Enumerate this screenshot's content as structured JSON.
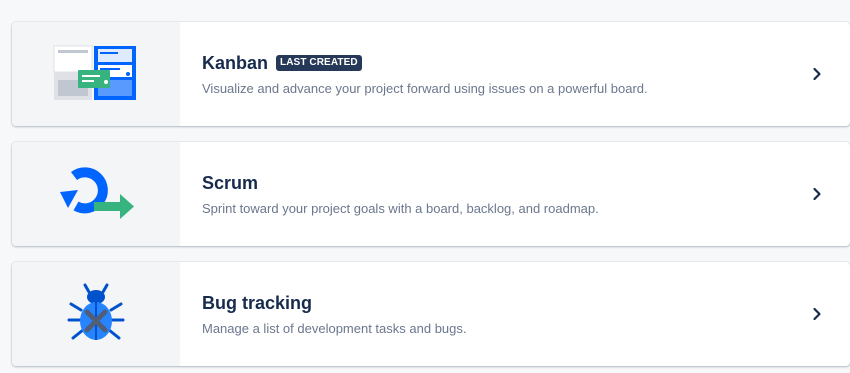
{
  "templates": [
    {
      "title": "Kanban",
      "badge": "LAST CREATED",
      "description": "Visualize and advance your project forward using issues on a powerful board.",
      "icon": "kanban-board-icon"
    },
    {
      "title": "Scrum",
      "badge": "",
      "description": "Sprint toward your project goals with a board, backlog, and roadmap.",
      "icon": "scrum-sprint-cycle-icon"
    },
    {
      "title": "Bug tracking",
      "badge": "",
      "description": "Manage a list of development tasks and bugs.",
      "icon": "bug-icon"
    }
  ],
  "colors": {
    "blue": "#0065ff",
    "green": "#36b37e",
    "title": "#172b4d",
    "description": "#6b778c",
    "badge_bg": "#253858"
  }
}
